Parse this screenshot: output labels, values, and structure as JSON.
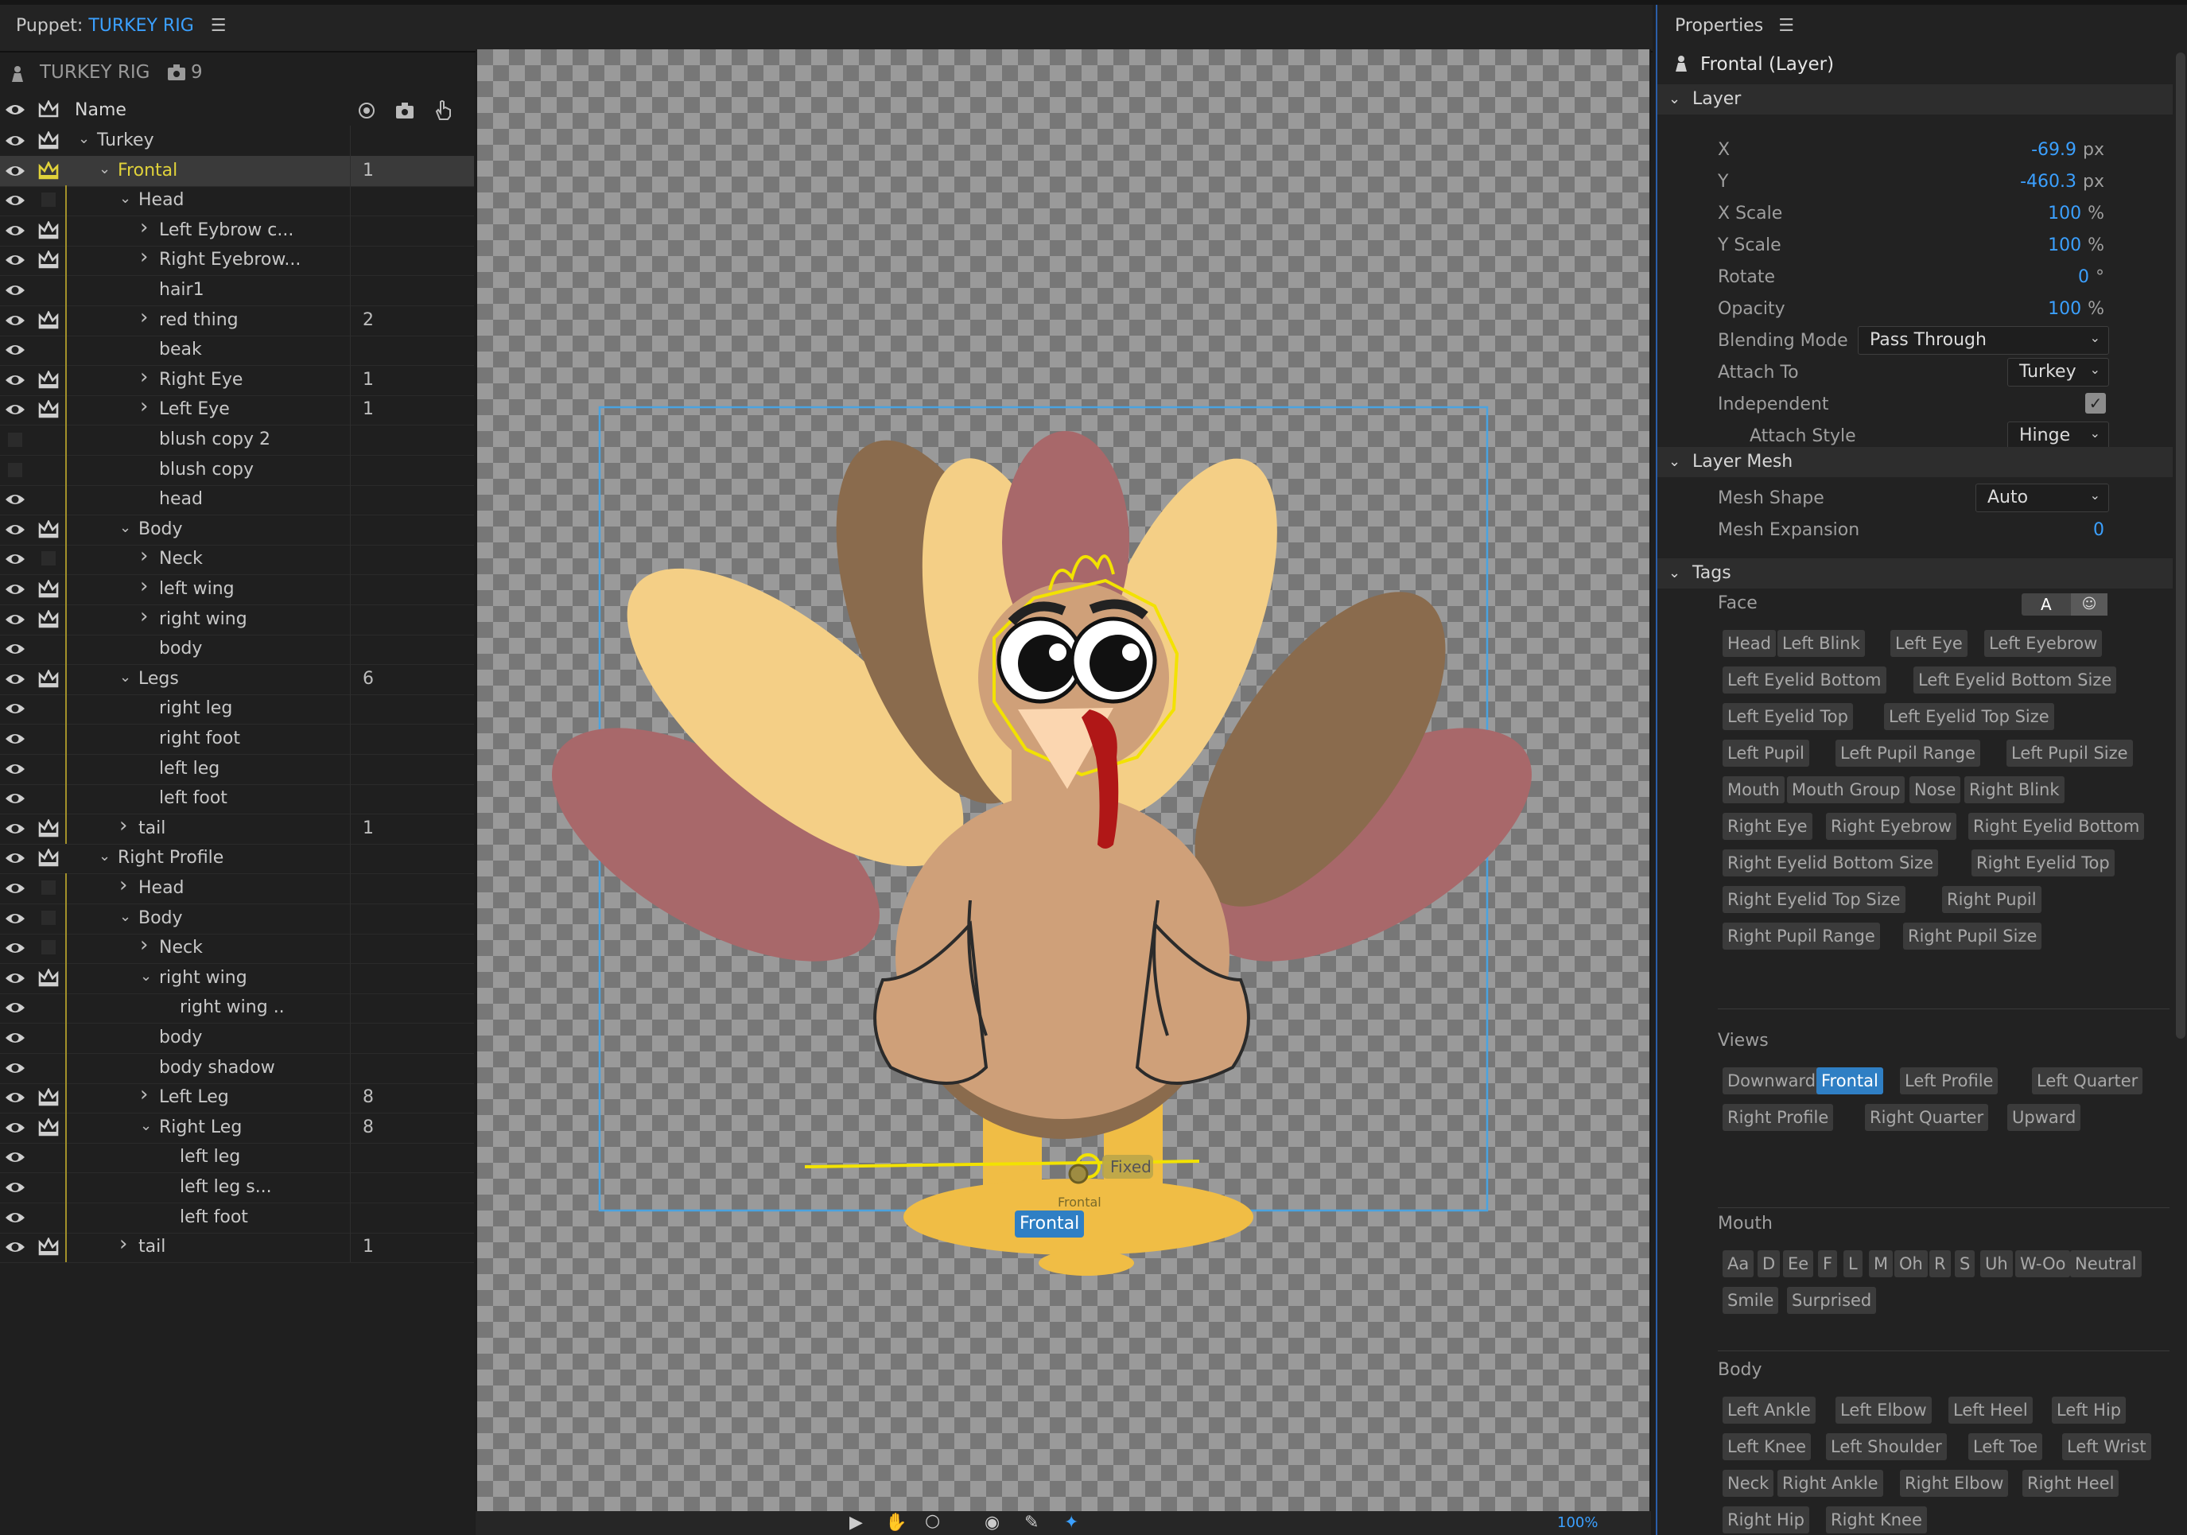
{
  "header": {
    "prefix": "Puppet: ",
    "name": "TURKEY RIG"
  },
  "puppet": {
    "name": "TURKEY RIG",
    "count": "9"
  },
  "columns": {
    "name": "Name"
  },
  "layers": [
    {
      "label": "Turkey",
      "level": 0,
      "tw": "v",
      "crown": true,
      "eye": true,
      "count": ""
    },
    {
      "label": "Frontal",
      "level": 1,
      "tw": "v",
      "crown": true,
      "eye": true,
      "count": "1",
      "sel": true
    },
    {
      "label": "Head",
      "level": 2,
      "tw": "v",
      "crown": false,
      "eye": true,
      "count": ""
    },
    {
      "label": "Left Eybrow c...",
      "level": 3,
      "tw": ">",
      "crown": true,
      "eye": true,
      "count": ""
    },
    {
      "label": "Right Eyebrow...",
      "level": 3,
      "tw": ">",
      "crown": true,
      "eye": true,
      "count": ""
    },
    {
      "label": "hair1",
      "level": 3,
      "tw": "",
      "crown": false,
      "eye": true,
      "count": ""
    },
    {
      "label": "red thing",
      "level": 3,
      "tw": ">",
      "crown": true,
      "eye": true,
      "count": "2"
    },
    {
      "label": "beak",
      "level": 3,
      "tw": "",
      "crown": false,
      "eye": true,
      "count": ""
    },
    {
      "label": "Right Eye",
      "level": 3,
      "tw": ">",
      "crown": true,
      "eye": true,
      "count": "1"
    },
    {
      "label": "Left Eye",
      "level": 3,
      "tw": ">",
      "crown": true,
      "eye": true,
      "count": "1"
    },
    {
      "label": "blush copy 2",
      "level": 3,
      "tw": "",
      "crown": false,
      "eye": false,
      "count": ""
    },
    {
      "label": "blush copy",
      "level": 3,
      "tw": "",
      "crown": false,
      "eye": false,
      "count": ""
    },
    {
      "label": "head",
      "level": 3,
      "tw": "",
      "crown": false,
      "eye": true,
      "count": ""
    },
    {
      "label": "Body",
      "level": 2,
      "tw": "v",
      "crown": true,
      "eye": true,
      "count": ""
    },
    {
      "label": "Neck",
      "level": 3,
      "tw": ">",
      "crown": false,
      "eye": true,
      "count": ""
    },
    {
      "label": "left wing",
      "level": 3,
      "tw": ">",
      "crown": true,
      "eye": true,
      "count": ""
    },
    {
      "label": "right wing",
      "level": 3,
      "tw": ">",
      "crown": true,
      "eye": true,
      "count": ""
    },
    {
      "label": "body",
      "level": 3,
      "tw": "",
      "crown": false,
      "eye": true,
      "count": ""
    },
    {
      "label": "Legs",
      "level": 2,
      "tw": "v",
      "crown": true,
      "eye": true,
      "count": "6"
    },
    {
      "label": "right leg",
      "level": 3,
      "tw": "",
      "crown": false,
      "eye": true,
      "count": ""
    },
    {
      "label": "right foot",
      "level": 3,
      "tw": "",
      "crown": false,
      "eye": true,
      "count": ""
    },
    {
      "label": "left leg",
      "level": 3,
      "tw": "",
      "crown": false,
      "eye": true,
      "count": ""
    },
    {
      "label": "left foot",
      "level": 3,
      "tw": "",
      "crown": false,
      "eye": true,
      "count": ""
    },
    {
      "label": "tail",
      "level": 2,
      "tw": ">",
      "crown": true,
      "eye": true,
      "count": "1"
    },
    {
      "label": "Right Profile",
      "level": 1,
      "tw": "v",
      "crown": true,
      "eye": true,
      "count": ""
    },
    {
      "label": "Head",
      "level": 2,
      "tw": ">",
      "crown": false,
      "eye": true,
      "count": ""
    },
    {
      "label": "Body",
      "level": 2,
      "tw": "v",
      "crown": false,
      "eye": true,
      "count": ""
    },
    {
      "label": "Neck",
      "level": 3,
      "tw": ">",
      "crown": false,
      "eye": true,
      "count": ""
    },
    {
      "label": "right wing",
      "level": 3,
      "tw": "v",
      "crown": true,
      "eye": true,
      "count": ""
    },
    {
      "label": "right wing ..",
      "level": 4,
      "tw": "",
      "crown": false,
      "eye": true,
      "count": ""
    },
    {
      "label": "body",
      "level": 3,
      "tw": "",
      "crown": false,
      "eye": true,
      "count": ""
    },
    {
      "label": "body shadow",
      "level": 3,
      "tw": "",
      "crown": false,
      "eye": true,
      "count": ""
    },
    {
      "label": "Left Leg",
      "level": 3,
      "tw": ">",
      "crown": true,
      "eye": true,
      "count": "8"
    },
    {
      "label": "Right Leg",
      "level": 3,
      "tw": "v",
      "crown": true,
      "eye": true,
      "count": "8"
    },
    {
      "label": "left leg",
      "level": 4,
      "tw": "",
      "crown": false,
      "eye": true,
      "count": ""
    },
    {
      "label": "left leg s...",
      "level": 4,
      "tw": "",
      "crown": false,
      "eye": true,
      "count": ""
    },
    {
      "label": "left foot",
      "level": 4,
      "tw": "",
      "crown": false,
      "eye": true,
      "count": ""
    },
    {
      "label": "tail",
      "level": 2,
      "tw": ">",
      "crown": true,
      "eye": true,
      "count": "1"
    }
  ],
  "canvas": {
    "handle_label": "Fixed",
    "small_label": "Frontal",
    "view_badge": "Frontal",
    "zoom": "100%"
  },
  "properties": {
    "title": "Properties",
    "subject": "Frontal (Layer)",
    "sections": {
      "layer": "Layer",
      "mesh": "Layer Mesh",
      "tags": "Tags"
    },
    "layer": {
      "x": {
        "label": "X",
        "value": "-69.9",
        "unit": "px"
      },
      "y": {
        "label": "Y",
        "value": "-460.3",
        "unit": "px"
      },
      "xscale": {
        "label": "X Scale",
        "value": "100",
        "unit": "%"
      },
      "yscale": {
        "label": "Y Scale",
        "value": "100",
        "unit": "%"
      },
      "rotate": {
        "label": "Rotate",
        "value": "0",
        "unit": "°"
      },
      "opacity": {
        "label": "Opacity",
        "value": "100",
        "unit": "%"
      },
      "blending": {
        "label": "Blending Mode",
        "value": "Pass Through"
      },
      "attach": {
        "label": "Attach To",
        "value": "Turkey"
      },
      "independent": {
        "label": "Independent"
      },
      "attach_style": {
        "label": "Attach Style",
        "value": "Hinge"
      }
    },
    "mesh": {
      "shape": {
        "label": "Mesh Shape",
        "value": "Auto"
      },
      "expansion": {
        "label": "Mesh Expansion",
        "value": "0"
      }
    },
    "tags": {
      "face_label": "Face",
      "face_toggle_a": "A",
      "face": [
        "Head",
        "Left Blink",
        "Left Eye",
        "Left Eyebrow",
        "Left Eyelid Bottom",
        "Left Eyelid Bottom Size",
        "Left Eyelid Top",
        "Left Eyelid Top Size",
        "Left Pupil",
        "Left Pupil Range",
        "Left Pupil Size",
        "Mouth",
        "Mouth Group",
        "Nose",
        "Right Blink",
        "Right Eye",
        "Right Eyebrow",
        "Right Eyelid Bottom",
        "Right Eyelid Bottom Size",
        "Right Eyelid Top",
        "Right Eyelid Top Size",
        "Right Pupil",
        "Right Pupil Range",
        "Right Pupil Size"
      ],
      "views_label": "Views",
      "views": [
        "Downward",
        "Frontal",
        "Left Profile",
        "Left Quarter",
        "Right Profile",
        "Right Quarter",
        "Upward"
      ],
      "views_active": "Frontal",
      "mouth_label": "Mouth",
      "mouth": [
        "Aa",
        "D",
        "Ee",
        "F",
        "L",
        "M",
        "Oh",
        "R",
        "S",
        "Uh",
        "W-Oo",
        "Neutral",
        "Smile",
        "Surprised"
      ],
      "body_label": "Body",
      "body": [
        "Left Ankle",
        "Left Elbow",
        "Left Heel",
        "Left Hip",
        "Left Knee",
        "Left Shoulder",
        "Left Toe",
        "Left Wrist",
        "Neck",
        "Right Ankle",
        "Right Elbow",
        "Right Heel",
        "Right Hip",
        "Right Knee"
      ]
    }
  },
  "colors": {
    "accent": "#3ba0ff",
    "selected_tag": "#2f7fc4",
    "selection_yellow": "#f2e200",
    "bounds": "#4aa3e0"
  }
}
